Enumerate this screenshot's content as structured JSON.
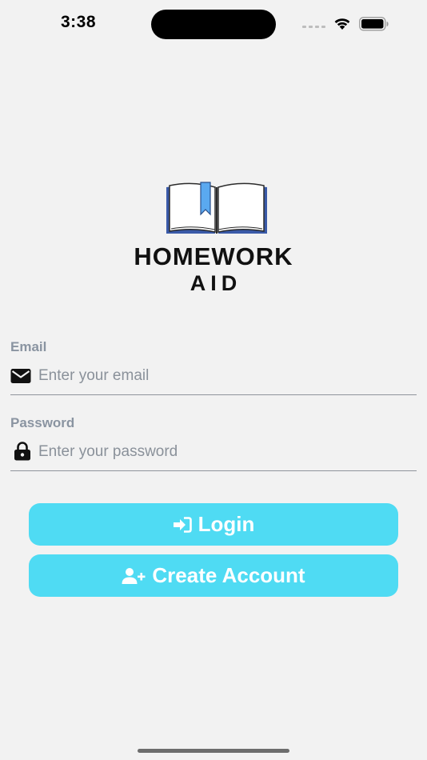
{
  "status_bar": {
    "time": "3:38"
  },
  "logo": {
    "line1": "HOMEWORK",
    "line2": "AID",
    "icon": "open-book-icon"
  },
  "form": {
    "email": {
      "label": "Email",
      "placeholder": "Enter your email",
      "value": "",
      "icon": "envelope-icon"
    },
    "password": {
      "label": "Password",
      "placeholder": "Enter your password",
      "value": "",
      "icon": "lock-icon"
    }
  },
  "buttons": {
    "login": {
      "label": "Login",
      "icon": "sign-in-icon"
    },
    "create_account": {
      "label": "Create Account",
      "icon": "user-plus-icon"
    }
  },
  "colors": {
    "background": "#f2f2f2",
    "button": "#4fdbf3",
    "button_text": "#ffffff",
    "label": "#8a94a1",
    "book_blue": "#3a5aa8",
    "bookmark": "#5aa9f0"
  }
}
